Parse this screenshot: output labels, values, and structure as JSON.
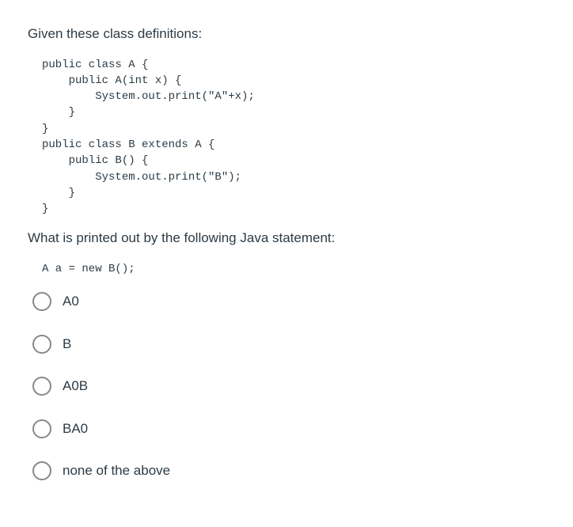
{
  "question": {
    "intro": "Given these class definitions:",
    "code1": "public class A {\n    public A(int x) {\n        System.out.print(\"A\"+x);\n    }\n}\npublic class B extends A {\n    public B() {\n        System.out.print(\"B\");\n    }\n}",
    "prompt": "What is printed out by the following Java statement:",
    "code2": "A a = new B();"
  },
  "options": [
    {
      "label": "A0"
    },
    {
      "label": "B"
    },
    {
      "label": "A0B"
    },
    {
      "label": "BA0"
    },
    {
      "label": "none of the above"
    }
  ]
}
